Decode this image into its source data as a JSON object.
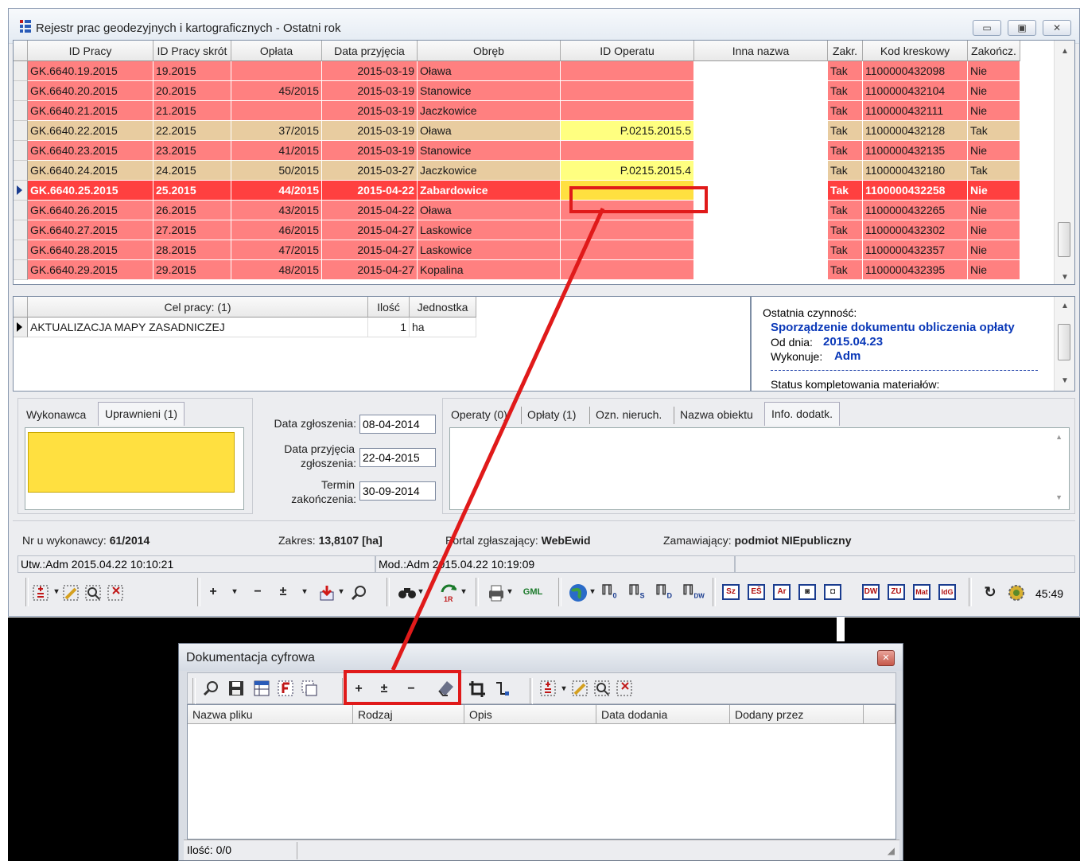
{
  "window": {
    "title": "Rejestr prac geodezyjnych i kartograficznych - Ostatni rok",
    "btn_min": "▭",
    "btn_max": "▣",
    "btn_close": "✕"
  },
  "grid": {
    "columns": [
      "ID Pracy",
      "ID Pracy skrót",
      "Opłata",
      "Data przyjęcia",
      "Obręb",
      "ID Operatu",
      "Inna nazwa",
      "Zakr.",
      "Kod kreskowy",
      "Zakończ."
    ],
    "rows": [
      {
        "id": "GK.6640.19.2015",
        "skrot": "19.2015",
        "oplata": "",
        "data": "2015-03-19",
        "obreb": "Oława",
        "operat": "",
        "inna": "",
        "zakr": "Tak",
        "kod": "1100000432098",
        "zak": "Nie",
        "style": "red"
      },
      {
        "id": "GK.6640.20.2015",
        "skrot": "20.2015",
        "oplata": "45/2015",
        "data": "2015-03-19",
        "obreb": "Stanowice",
        "operat": "",
        "inna": "",
        "zakr": "Tak",
        "kod": "1100000432104",
        "zak": "Nie",
        "style": "red"
      },
      {
        "id": "GK.6640.21.2015",
        "skrot": "21.2015",
        "oplata": "",
        "data": "2015-03-19",
        "obreb": "Jaczkowice",
        "operat": "",
        "inna": "",
        "zakr": "Tak",
        "kod": "1100000432111",
        "zak": "Nie",
        "style": "red"
      },
      {
        "id": "GK.6640.22.2015",
        "skrot": "22.2015",
        "oplata": "37/2015",
        "data": "2015-03-19",
        "obreb": "Oława",
        "operat": "P.0215.2015.5",
        "inna": "",
        "zakr": "Tak",
        "kod": "1100000432128",
        "zak": "Tak",
        "style": "tan"
      },
      {
        "id": "GK.6640.23.2015",
        "skrot": "23.2015",
        "oplata": "41/2015",
        "data": "2015-03-19",
        "obreb": "Stanowice",
        "operat": "",
        "inna": "",
        "zakr": "Tak",
        "kod": "1100000432135",
        "zak": "Nie",
        "style": "red"
      },
      {
        "id": "GK.6640.24.2015",
        "skrot": "24.2015",
        "oplata": "50/2015",
        "data": "2015-03-27",
        "obreb": "Jaczkowice",
        "operat": "P.0215.2015.4",
        "inna": "",
        "zakr": "Tak",
        "kod": "1100000432180",
        "zak": "Tak",
        "style": "tan"
      },
      {
        "id": "GK.6640.25.2015",
        "skrot": "25.2015",
        "oplata": "44/2015",
        "data": "2015-04-22",
        "obreb": "Zabardowice",
        "operat": "",
        "inna": "",
        "zakr": "Tak",
        "kod": "1100000432258",
        "zak": "Nie",
        "style": "sel"
      },
      {
        "id": "GK.6640.26.2015",
        "skrot": "26.2015",
        "oplata": "43/2015",
        "data": "2015-04-22",
        "obreb": "Oława",
        "operat": "",
        "inna": "",
        "zakr": "Tak",
        "kod": "1100000432265",
        "zak": "Nie",
        "style": "red"
      },
      {
        "id": "GK.6640.27.2015",
        "skrot": "27.2015",
        "oplata": "46/2015",
        "data": "2015-04-27",
        "obreb": "Laskowice",
        "operat": "",
        "inna": "",
        "zakr": "Tak",
        "kod": "1100000432302",
        "zak": "Nie",
        "style": "red"
      },
      {
        "id": "GK.6640.28.2015",
        "skrot": "28.2015",
        "oplata": "47/2015",
        "data": "2015-04-27",
        "obreb": "Laskowice",
        "operat": "",
        "inna": "",
        "zakr": "Tak",
        "kod": "1100000432357",
        "zak": "Nie",
        "style": "red"
      },
      {
        "id": "GK.6640.29.2015",
        "skrot": "29.2015",
        "oplata": "48/2015",
        "data": "2015-04-27",
        "obreb": "Kopalina",
        "operat": "",
        "inna": "",
        "zakr": "Tak",
        "kod": "1100000432395",
        "zak": "Nie",
        "style": "red"
      }
    ]
  },
  "colors": {
    "row_red": "#ff8080",
    "row_tan": "#e8cca0",
    "row_sel": "#ff4040",
    "operat_yellow": "#ffff80",
    "sel_yellow": "#ffe040",
    "annot_red": "#e01a1a"
  },
  "cel": {
    "header_cel": "Cel pracy: (1)",
    "header_ilosc": "Ilość",
    "header_jedn": "Jednostka",
    "row_cel": "AKTUALIZACJA MAPY ZASADNICZEJ",
    "row_ilosc": "1",
    "row_jedn": "ha"
  },
  "last_action": {
    "label": "Ostatnia czynność:",
    "action": "Sporządzenie dokumentu obliczenia opłaty",
    "od_label": "Od dnia:",
    "od_value": "2015.04.23",
    "wyk_label": "Wykonuje:",
    "wyk_value": "Adm",
    "status": "Status kompletowania materiałów:"
  },
  "left_panel": {
    "tab1": "Wykonawca",
    "tab2": "Uprawnieni (1)"
  },
  "dates": {
    "zgl_label": "Data zgłoszenia:",
    "zgl_value": "08-04-2014",
    "przyj_label1": "Data przyjęcia",
    "przyj_label2": "zgłoszenia:",
    "przyj_value": "22-04-2015",
    "term_label1": "Termin",
    "term_label2": "zakończenia:",
    "term_value": "30-09-2014"
  },
  "right_tabs": [
    "Operaty (0)",
    "Opłaty (1)",
    "Ozn. nieruch.",
    "Nazwa obiektu",
    "Info. dodatk."
  ],
  "info": {
    "nr_label": "Nr u wykonawcy:",
    "nr_value": "61/2014",
    "zakres_label": "Zakres:",
    "zakres_value": "13,8107 [ha]",
    "portal_label": "Portal zgłaszający:",
    "portal_value": "WebEwid",
    "zam_label": "Zamawiający:",
    "zam_value": "podmiot NIEpubliczny"
  },
  "status": {
    "utw": "Utw.:Adm 2015.04.22 10:10:21",
    "mod": "Mod.:Adm 2015.04.22 10:19:09"
  },
  "toolbar": {
    "clock": "45:49",
    "plus": "+",
    "minus": "−",
    "plusminus": "±",
    "dropdown": "▾",
    "gml": "GML",
    "i_sz": "Sz",
    "i_es": "EŠ",
    "i_ar": "Ar",
    "i_dw": "DW",
    "i_zu": "ZU",
    "i_mat": "Mat",
    "i_idg": "IdG",
    "m0": "0",
    "ms": "S",
    "md": "D",
    "mdw": "DW"
  },
  "dialog": {
    "title": "Dokumentacja cyfrowa",
    "columns": [
      "Nazwa pliku",
      "Rodzaj",
      "Opis",
      "Data dodania",
      "Dodany przez"
    ],
    "status": "Ilość: 0/0"
  }
}
